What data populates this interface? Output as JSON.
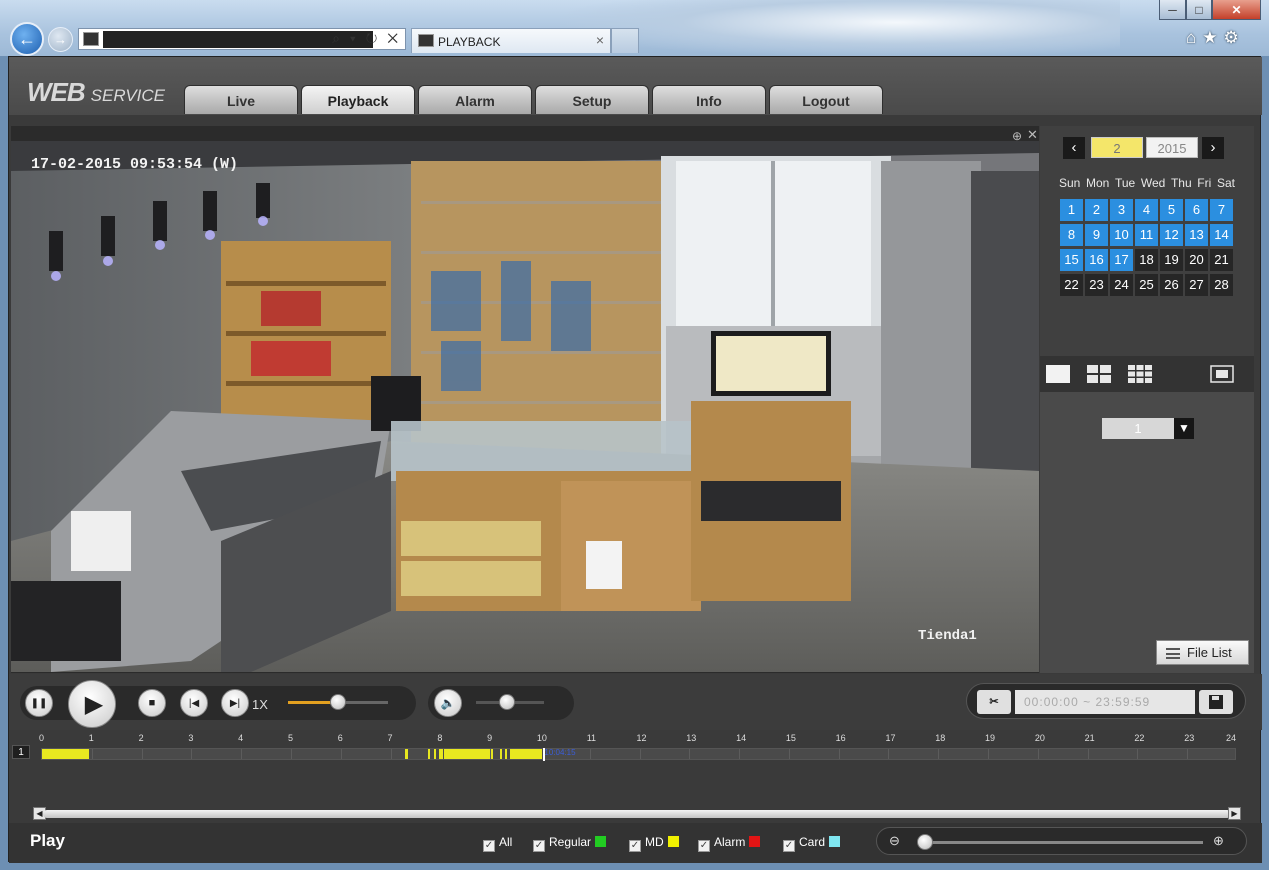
{
  "browser": {
    "tab_title": "PLAYBACK",
    "tab_close": "×",
    "addr_controls": "⌕ ▾ ↻ ✕",
    "window_controls": {
      "minimize": "─",
      "maximize": "□",
      "close": "✕"
    },
    "icons": [
      "home-icon",
      "star-icon",
      "gear-icon"
    ]
  },
  "app": {
    "logo_main": "WEB",
    "logo_sub": "SERVICE",
    "nav": [
      "Live",
      "Playback",
      "Alarm",
      "Setup",
      "Info",
      "Logout"
    ],
    "active_nav": "Playback"
  },
  "video": {
    "timestamp": "17-02-2015 09:53:54 (W)",
    "camera_name": "Tienda1"
  },
  "calendar": {
    "month": "2",
    "year": "2015",
    "prev": "‹",
    "next": "›",
    "weekdays": [
      "Sun",
      "Mon",
      "Tue",
      "Wed",
      "Thu",
      "Fri",
      "Sat"
    ],
    "days": [
      "1",
      "2",
      "3",
      "4",
      "5",
      "6",
      "7",
      "8",
      "9",
      "10",
      "11",
      "12",
      "13",
      "14",
      "15",
      "16",
      "17",
      "18",
      "19",
      "20",
      "21",
      "22",
      "23",
      "24",
      "25",
      "26",
      "27",
      "28"
    ],
    "days_with_records": [
      1,
      2,
      3,
      4,
      5,
      6,
      7,
      8,
      9,
      10,
      11,
      12,
      13,
      14,
      15,
      16,
      17
    ]
  },
  "channel_select": {
    "value": "1"
  },
  "file_list_label": "File List",
  "controls": {
    "speed": "1X",
    "speed_level": 0.5,
    "volume_level": 0.45,
    "clip_time": {
      "h1": "00",
      "m1": "00",
      "s1": "00",
      "h2": "23",
      "m2": "59",
      "s2": "59"
    }
  },
  "timeline": {
    "channel": "1",
    "hours": [
      "0",
      "1",
      "2",
      "3",
      "4",
      "5",
      "6",
      "7",
      "8",
      "9",
      "10",
      "11",
      "12",
      "13",
      "14",
      "15",
      "16",
      "17",
      "18",
      "19",
      "20",
      "21",
      "22",
      "23",
      "24"
    ],
    "segments": [
      [
        0,
        0.95
      ],
      [
        7.3,
        7.36
      ],
      [
        7.75,
        7.8
      ],
      [
        7.88,
        7.92
      ],
      [
        7.97,
        8.05
      ],
      [
        8.08,
        9.0
      ],
      [
        9.02,
        9.05
      ],
      [
        9.2,
        9.24
      ],
      [
        9.3,
        9.34
      ],
      [
        9.4,
        10.05
      ]
    ],
    "cursor_time": "10:04:15",
    "cursor_hour": 10.07
  },
  "status": {
    "mode": "Play"
  },
  "legend": [
    {
      "label": "All",
      "color": ""
    },
    {
      "label": "Regular",
      "color": "#22cc22"
    },
    {
      "label": "MD",
      "color": "#f0f000"
    },
    {
      "label": "Alarm",
      "color": "#e21414"
    },
    {
      "label": "Card",
      "color": "#7fe6f0"
    }
  ],
  "zoom_level": 0
}
